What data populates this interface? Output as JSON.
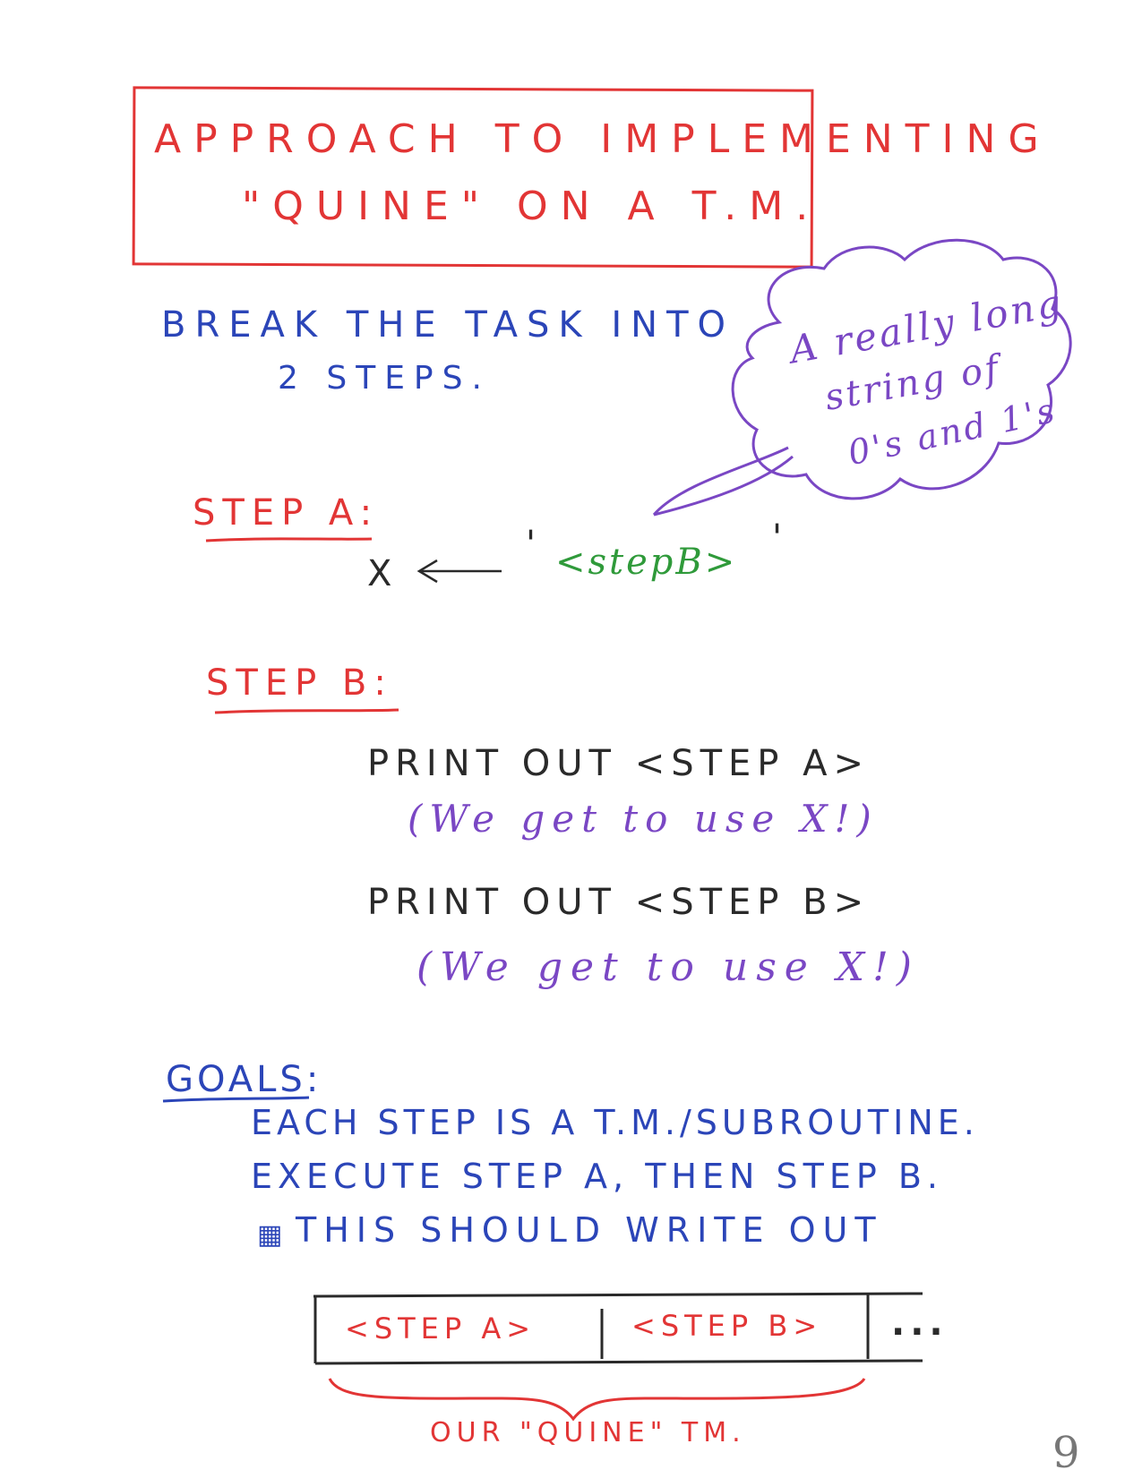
{
  "title": {
    "line1": "APPROACH  TO  IMPLEMENTING",
    "line2": "\"QUINE\"  ON  A  T.M."
  },
  "intro": {
    "line1": "BREAK  THE  TASK  INTO",
    "line2": "2  STEPS."
  },
  "cloud": {
    "line1": "A really long",
    "line2": "string of",
    "line3": "0's and 1's"
  },
  "step_a": {
    "label": "STEP A:",
    "variable": "X",
    "open_quote": "'",
    "body": "<stepB>",
    "close_quote": "'"
  },
  "step_b": {
    "label": "STEP B:",
    "print_a": "PRINT OUT <STEP A>",
    "note_a": "(We get to use X!)",
    "print_b": "PRINT OUT <STEP B>",
    "note_b": "(We get to use X!)"
  },
  "goals": {
    "label": "GOALS:",
    "line1": "EACH STEP IS A T.M./SUBROUTINE.",
    "line2": "EXECUTE STEP A, THEN STEP B.",
    "line3": "THIS SHOULD WRITE OUT"
  },
  "tape": {
    "cell_a": "<STEP A>",
    "cell_b": "<STEP B>",
    "ellipsis": "...",
    "caption": "OUR  \"QUINE\"  TM."
  },
  "page_number": "9"
}
